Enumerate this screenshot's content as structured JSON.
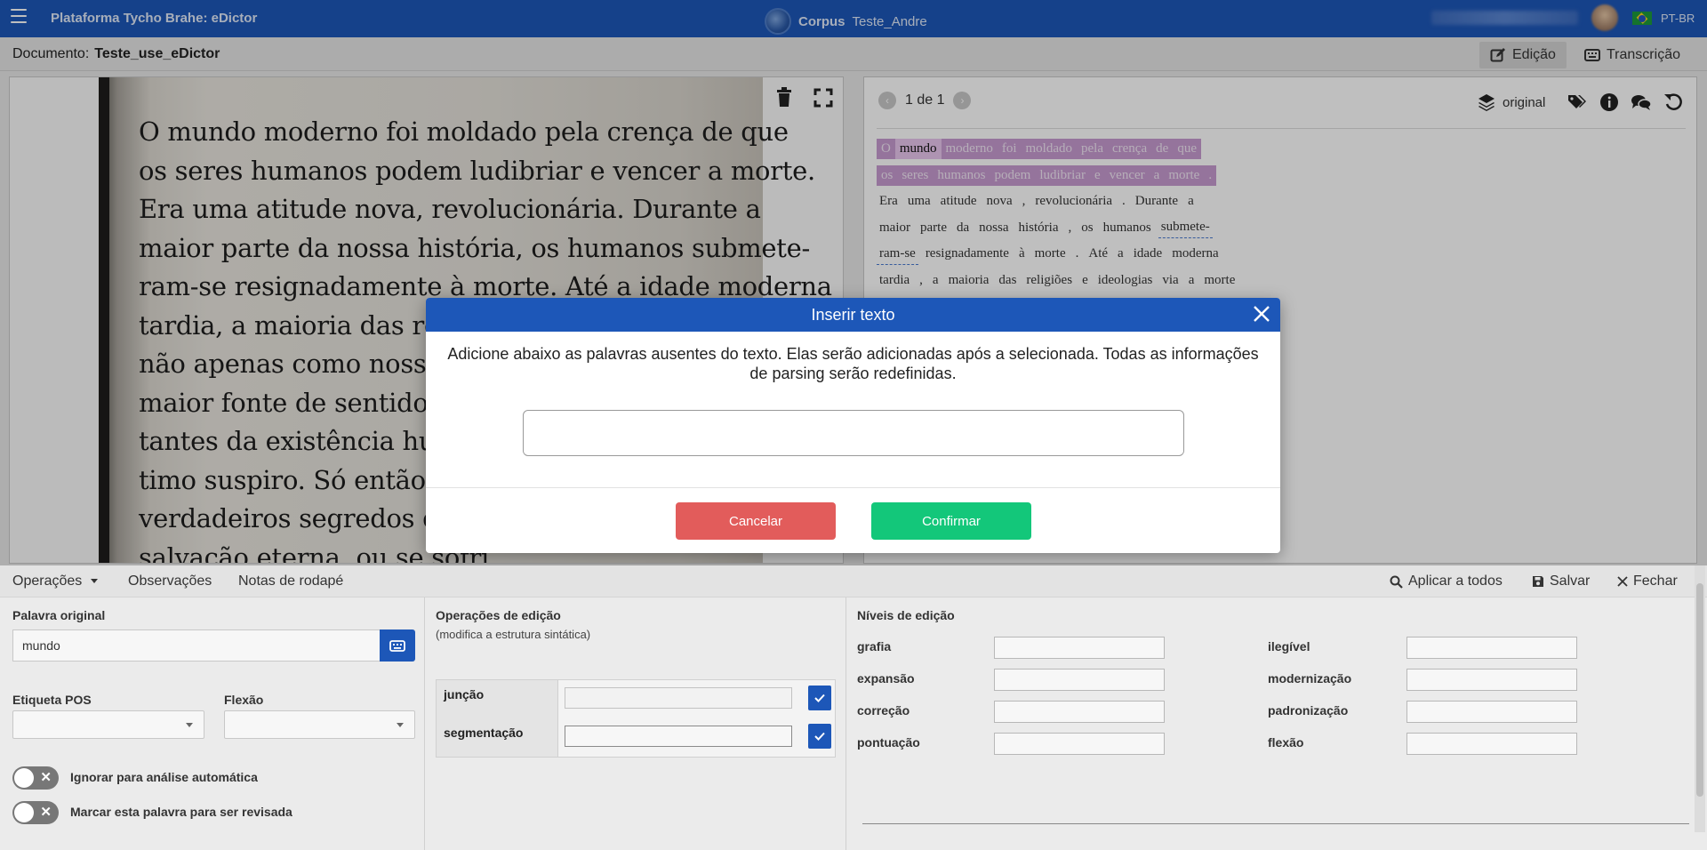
{
  "topbar": {
    "app_title": "Plataforma Tycho Brahe: eDictor",
    "corpus_label": "Corpus",
    "corpus_name": "Teste_Andre",
    "language": "PT-BR"
  },
  "docbar": {
    "label": "Documento:",
    "name": "Teste_use_eDictor",
    "tab_edit": "Edição",
    "tab_transcription": "Transcrição"
  },
  "image_panel": {
    "lines": [
      "O mundo moderno foi moldado pela crença de que",
      "os seres humanos podem ludibriar e vencer a morte.",
      "Era uma atitude nova, revolucionária. Durante a",
      "maior parte da nossa história, os humanos submete-",
      "ram-se resignadamente à morte. Até a idade moderna",
      "tardia, a maioria das religiõ",
      "não apenas como nosso dest",
      "maior fonte de sentido na vi",
      "tantes da existência humana",
      "timo suspiro. Só então a p",
      "verdadeiros segredos da vid",
      "salvação eterna, ou se sofri"
    ]
  },
  "text_panel": {
    "pager": "1 de 1",
    "layer": "original",
    "line1": [
      "O",
      "mundo",
      "moderno",
      "foi",
      "moldado",
      "pela",
      "crença",
      "de",
      "que"
    ],
    "line2": [
      "os",
      "seres",
      "humanos",
      "podem",
      "ludibriar",
      "e",
      "vencer",
      "a",
      "morte",
      "."
    ],
    "line3": [
      "Era",
      "uma",
      "atitude",
      "nova",
      ",",
      "revolucionária",
      ".",
      "Durante",
      "a"
    ],
    "line4": [
      "maior",
      "parte",
      "da",
      "nossa",
      "história",
      ",",
      "os",
      "humanos",
      "submete-"
    ],
    "line5": [
      "ram-se",
      "resignadamente",
      "à",
      "morte",
      ".",
      "Até",
      "a",
      "idade",
      "moderna"
    ],
    "line6": [
      "tardia",
      ",",
      "a",
      "maioria",
      "das",
      "religiões",
      "e",
      "ideologias",
      "via",
      "a",
      "morte"
    ]
  },
  "modal": {
    "title": "Inserir texto",
    "description": "Adicione abaixo as palavras ausentes do texto. Elas serão adicionadas após a selecionada. Todas as informações de parsing serão redefinidas.",
    "input_value": "",
    "cancel_label": "Cancelar",
    "confirm_label": "Confirmar"
  },
  "bottom": {
    "toolbar": {
      "operations": "Operações",
      "observations": "Observações",
      "footnotes": "Notas de rodapé",
      "apply_all": "Aplicar a todos",
      "save": "Salvar",
      "close": "Fechar"
    },
    "word": {
      "label": "Palavra original",
      "value": "mundo",
      "pos_label": "Etiqueta POS",
      "flexion_label": "Flexão",
      "ignore_label": "Ignorar para análise automática",
      "review_label": "Marcar esta palavra para ser revisada"
    },
    "edit_ops": {
      "title": "Operações de edição",
      "subtitle": "(modifica a estrutura sintática)",
      "junction": "junção",
      "segmentation": "segmentação"
    },
    "levels": {
      "title": "Níveis de edição",
      "left": [
        "grafia",
        "expansão",
        "correção",
        "pontuação"
      ],
      "right": [
        "ilegível",
        "modernização",
        "padronização",
        "flexão"
      ]
    }
  }
}
